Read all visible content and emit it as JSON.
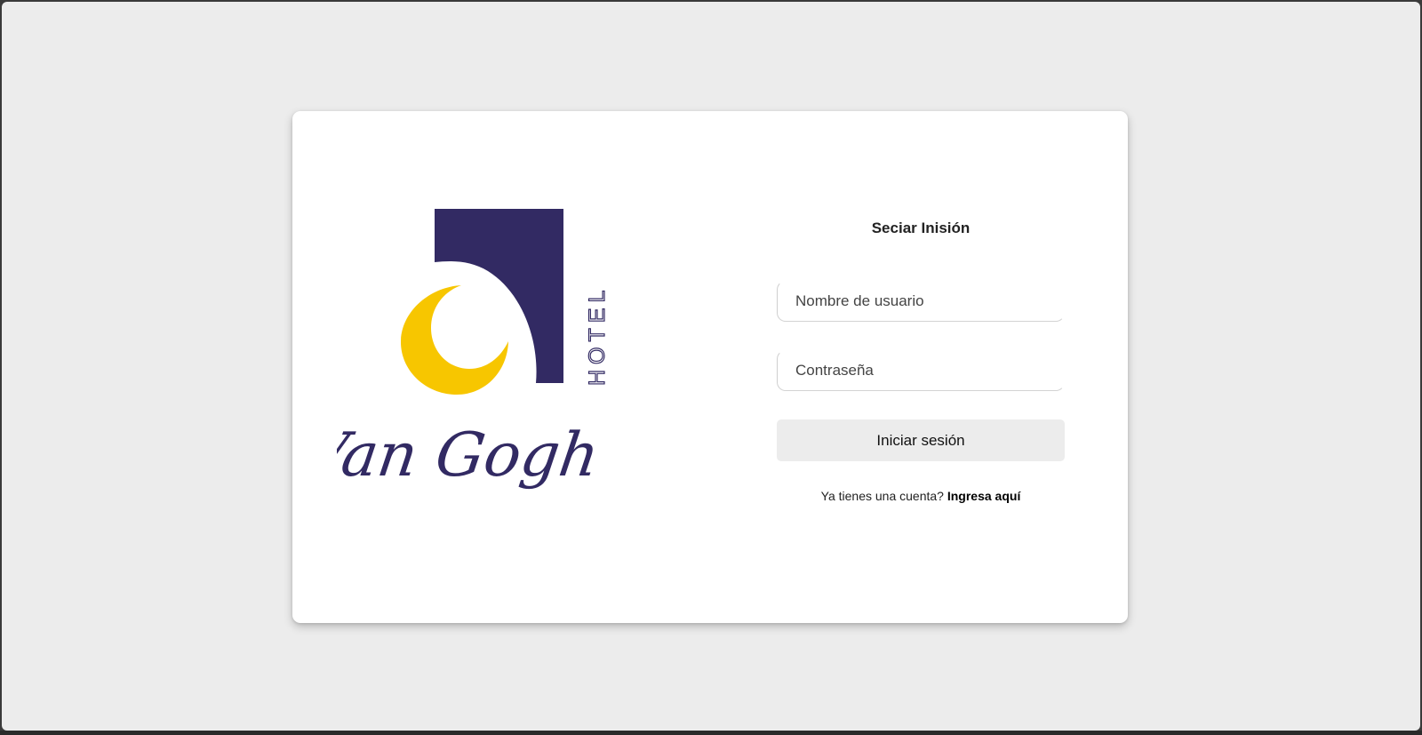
{
  "logo": {
    "word_hotel": "HOTEL",
    "word_name": "Van Gogh",
    "colors": {
      "navy": "#322a63",
      "moon": "#f7c600"
    }
  },
  "form": {
    "title": "Seciar Inisión",
    "username_placeholder": "Nombre de usuario",
    "password_placeholder": "Contraseña",
    "submit_label": "Iniciar sesión",
    "signup_prompt": "Ya tienes una cuenta?",
    "signup_link": "Ingresa aquí"
  },
  "colors": {
    "page_background": "#ececec",
    "card_background": "#ffffff",
    "button_background": "#ececec"
  }
}
